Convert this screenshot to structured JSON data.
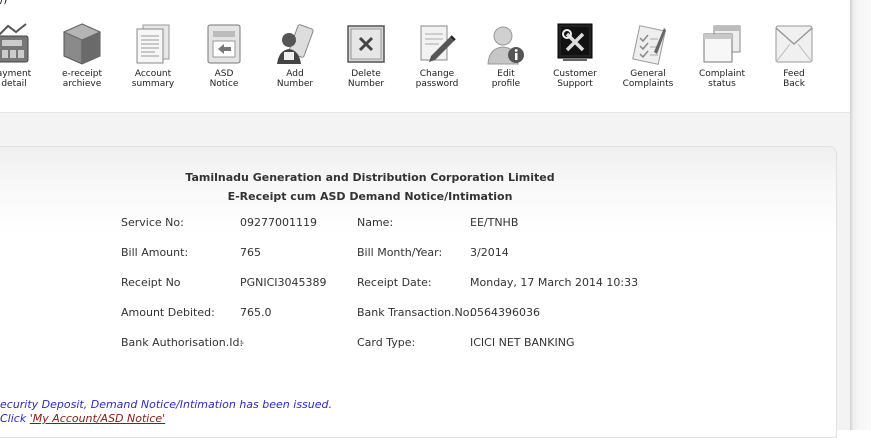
{
  "top_mark": "/)",
  "toolbar": {
    "items": [
      {
        "label": "ayment\ndetail",
        "icon": "payment-detail-icon"
      },
      {
        "label": "e-receipt\narchieve",
        "icon": "archive-box-icon"
      },
      {
        "label": "Account\nsummary",
        "icon": "document-icon"
      },
      {
        "label": "ASD\nNotice",
        "icon": "notice-icon"
      },
      {
        "label": "Add\nNumber",
        "icon": "add-user-icon"
      },
      {
        "label": "Delete\nNumber",
        "icon": "delete-icon"
      },
      {
        "label": "Change\npassword",
        "icon": "edit-document-icon"
      },
      {
        "label": "Edit\nprofile",
        "icon": "user-info-icon"
      },
      {
        "label": "Customer\nSupport",
        "icon": "tools-icon"
      },
      {
        "label": "General\nComplaints",
        "icon": "checklist-icon"
      },
      {
        "label": "Complaint\nstatus",
        "icon": "windows-icon"
      },
      {
        "label": "Feed\nBack",
        "icon": "envelope-icon"
      }
    ]
  },
  "receipt": {
    "org_title": "Tamilnadu Generation and Distribution Corporation Limited",
    "doc_title": "E-Receipt cum ASD Demand Notice/Intimation",
    "rows": [
      {
        "l1": "Service No:",
        "v1": "09277001119",
        "l2": "Name:",
        "v2": "EE/TNHB"
      },
      {
        "l1": "Bill Amount:",
        "v1": "765",
        "l2": "Bill Month/Year:",
        "v2": "3/2014"
      },
      {
        "l1": "Receipt No",
        "v1": "PGNICI3045389",
        "l2": "Receipt Date:",
        "v2": "Monday, 17 March 2014 10:33"
      },
      {
        "l1": "Amount Debited:",
        "v1": "765.0",
        "l2": "Bank Transaction.No:",
        "v2": "0564396036"
      },
      {
        "l1": "Bank Authorisation.Id:",
        "v1": "-",
        "l2": "Card Type:",
        "v2": "ICICI NET BANKING"
      }
    ]
  },
  "notice": {
    "line1": "ecurity Deposit, Demand Notice/Intimation has been issued.",
    "line2_prefix": "Click ",
    "link_text": "'My Account/ASD Notice'"
  },
  "colors": {
    "notice_text": "#2b2bbf",
    "link_text": "#8b1a1a"
  }
}
